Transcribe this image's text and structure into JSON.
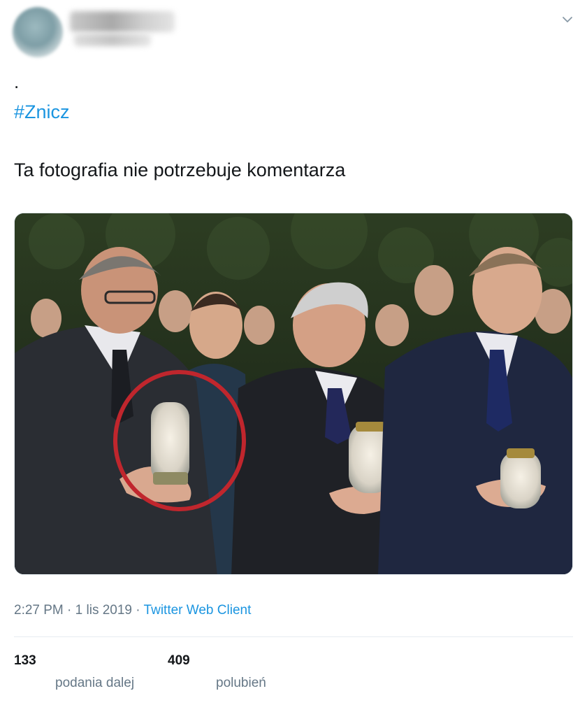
{
  "icons": {
    "menu": "chevron-down-icon"
  },
  "colors": {
    "link": "#1b95e0",
    "meta_text": "#657786",
    "body_text": "#14171a",
    "highlight_circle": "#c0262d"
  },
  "tweet": {
    "dot": ".",
    "hashtag": "#Znicz",
    "text": "Ta fotografia nie potrzebuje komentarza",
    "time": "2:27 PM",
    "date": "1 lis 2019",
    "separator": "·",
    "client": "Twitter Web Client"
  },
  "stats": {
    "retweets": {
      "count": "133",
      "label": "podania dalej"
    },
    "likes": {
      "count": "409",
      "label": "polubień"
    }
  }
}
